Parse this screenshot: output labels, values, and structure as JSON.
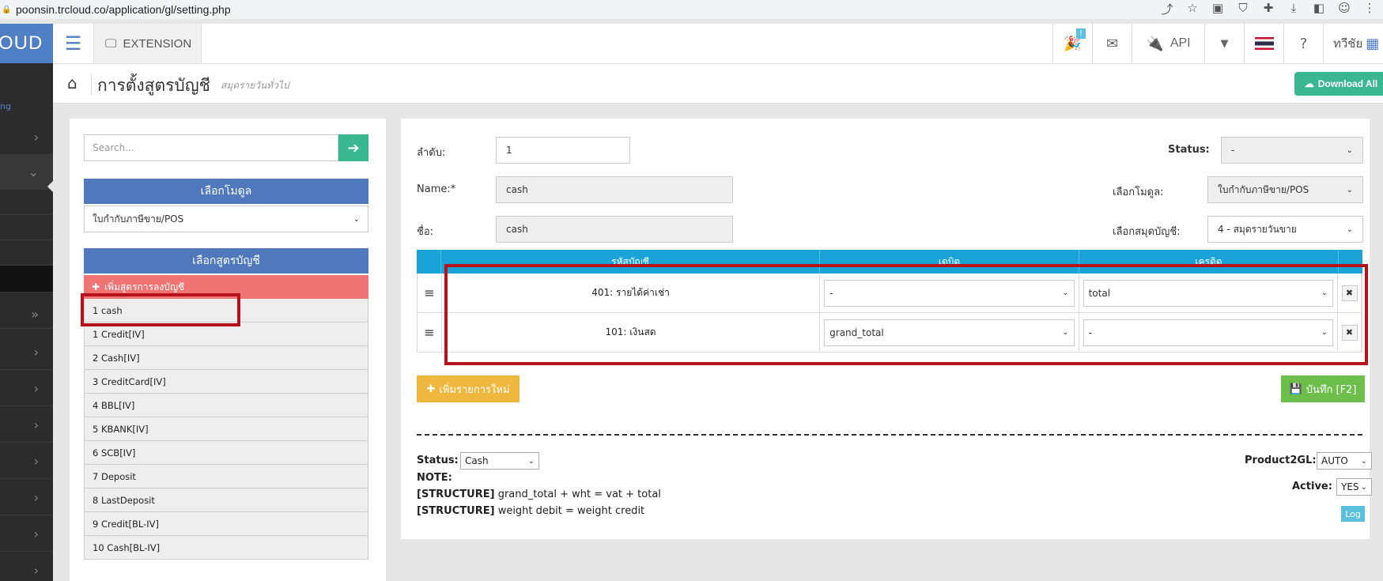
{
  "browser": {
    "url": "poonsin.trcloud.co/application/gl/setting.php"
  },
  "brand": {
    "text": "OUD"
  },
  "rail": {
    "ng_text": "ng"
  },
  "topbar": {
    "extension_label": "EXTENSION",
    "notification_badge": "!",
    "api_label": "API",
    "user_name": "ทวีชัย"
  },
  "page": {
    "title": "การตั้งสูตรบัญชี",
    "subtitle": "สมุดรายวันทั่วไป",
    "download_all_label": "Download All"
  },
  "left_panel": {
    "search_placeholder": "Search...",
    "module_heading": "เลือกโมดูล",
    "module_selected": "ใบกำกับภาษีขาย/POS",
    "formula_heading": "เลือกสูตรบัญชี",
    "add_formula_label": "เพิ่มสูตรการลงบัญชี",
    "formulas": [
      "1 cash",
      "1 Credit[IV]",
      "2 Cash[IV]",
      "3 CreditCard[IV]",
      "4 BBL[IV]",
      "5 KBANK[IV]",
      "6 SCB[IV]",
      "7 Deposit",
      "8 LastDeposit",
      "9 Credit[BL-IV]",
      "10 Cash[BL-IV]"
    ]
  },
  "form": {
    "order_label": "ลำดับ:",
    "order_value": "1",
    "name_label": "Name:*",
    "name_value": "cash",
    "thai_name_label": "ชื่อ:",
    "thai_name_value": "cash",
    "status_label": "Status:",
    "status_value": "-",
    "module_label": "เลือกโมดูล:",
    "module_value": "ใบกำกับภาษีขาย/POS",
    "journal_label": "เลือกสมุดบัญชี:",
    "journal_value": "4 - สมุดรายวันขาย"
  },
  "table": {
    "headers": [
      "รหัสบัญชี",
      "เดบิต",
      "เครดิต"
    ],
    "rows": [
      {
        "account": "401: รายได้ค่าเช่า",
        "debit": "-",
        "credit": "total"
      },
      {
        "account": "101: เงินสด",
        "debit": "grand_total",
        "credit": "-"
      }
    ]
  },
  "actions": {
    "add_row_label": "เพิ่มรายการใหม่",
    "save_label": "บันทึก [F2]"
  },
  "footer": {
    "status_label": "Status:",
    "status_value": "Cash",
    "note_label": "NOTE:",
    "structure_tag": "[STRUCTURE]",
    "structure_1": "grand_total + wht = vat + total",
    "structure_2": "weight debit = weight credit",
    "product2gl_label": "Product2GL:",
    "product2gl_value": "AUTO",
    "active_label": "Active:",
    "active_value": "YES",
    "log_label": "Log"
  },
  "colors": {
    "brand_blue": "#4f80c5",
    "accent_green": "#3bb78f",
    "table_head": "#1aa3d6",
    "annotation_red": "#b5121b"
  }
}
